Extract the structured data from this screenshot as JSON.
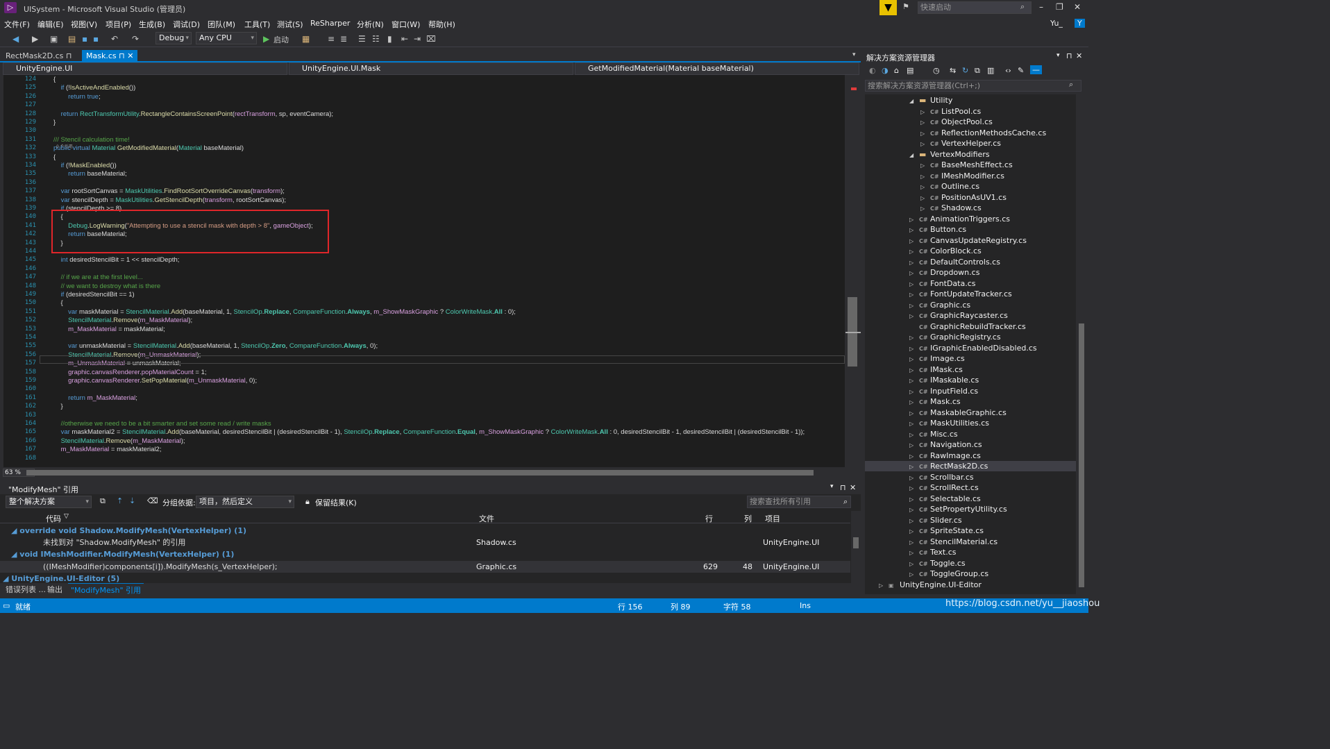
{
  "window": {
    "title": "UISystem - Microsoft Visual Studio (管理员)",
    "quick_launch": "快速启动",
    "user": "Yu_",
    "user_icon": "Y"
  },
  "menu": [
    "文件(F)",
    "编辑(E)",
    "视图(V)",
    "项目(P)",
    "生成(B)",
    "调试(D)",
    "团队(M)",
    "工具(T)",
    "测试(S)",
    "ReSharper",
    "分析(N)",
    "窗口(W)",
    "帮助(H)"
  ],
  "toolbar": {
    "config": "Debug",
    "platform": "Any CPU",
    "start": "启动"
  },
  "tabs": [
    {
      "label": "RectMask2D.cs",
      "pin": "⊓"
    },
    {
      "label": "Mask.cs",
      "pin": "⊓",
      "close": "✕"
    }
  ],
  "navbar": {
    "project": "UnityEngine.UI",
    "class": "UnityEngine.UI.Mask",
    "member": "GetModifiedMaterial(Material baseMaterial)"
  },
  "zoom": "63 %",
  "code_lines": [
    {
      "n": "124",
      "html": "{"
    },
    {
      "n": "125",
      "html": "    <span class='kw'>if</span> (!<span class='fn'>IsActiveAndEnabled</span>())"
    },
    {
      "n": "126",
      "html": "        <span class='kw'>return</span> <span class='kw'>true</span>;"
    },
    {
      "n": "127",
      "html": ""
    },
    {
      "n": "128",
      "html": "    <span class='kw'>return</span> <span class='ty'>RectTransformUtility</span>.<span class='fn'>RectangleContainsScreenPoint</span>(<span class='pr'>rectTransform</span>, sp, eventCamera);"
    },
    {
      "n": "129",
      "html": "}"
    },
    {
      "n": "130",
      "html": ""
    },
    {
      "n": "131",
      "html": "<span class='cm'>/// Stencil calculation time!</span>"
    },
    {
      "n": "132",
      "html": "<span class='kw'>public virtual</span> <span class='ty'>Material</span> <span class='fn'>GetModifiedMaterial</span>(<span class='ty'>Material</span> baseMaterial)"
    },
    {
      "n": "133",
      "html": "{"
    },
    {
      "n": "134",
      "html": "    <span class='kw'>if</span> (!<span class='fn'>MaskEnabled</span>())"
    },
    {
      "n": "135",
      "html": "        <span class='kw'>return</span> baseMaterial;"
    },
    {
      "n": "136",
      "html": ""
    },
    {
      "n": "137",
      "html": "    <span class='kw'>var</span> rootSortCanvas = <span class='ty'>MaskUtilities</span>.<span class='fn'>FindRootSortOverrideCanvas</span>(<span class='pr'>transform</span>);"
    },
    {
      "n": "138",
      "html": "    <span class='kw'>var</span> stencilDepth = <span class='ty'>MaskUtilities</span>.<span class='fn'>GetStencilDepth</span>(<span class='pr'>transform</span>, rootSortCanvas);"
    },
    {
      "n": "139",
      "html": "    <span class='kw'>if</span> (stencilDepth >= 8)"
    },
    {
      "n": "140",
      "html": "    {"
    },
    {
      "n": "141",
      "html": "        <span class='ty'>Debug</span>.<span class='fn'>LogWarning</span>(<span class='st'>\"Attempting to use a stencil mask with depth > 8\"</span>, <span class='pr'>gameObject</span>);"
    },
    {
      "n": "142",
      "html": "        <span class='kw'>return</span> baseMaterial;"
    },
    {
      "n": "143",
      "html": "    }"
    },
    {
      "n": "144",
      "html": ""
    },
    {
      "n": "145",
      "html": "    <span class='kw'>int</span> desiredStencilBit = 1 << stencilDepth;"
    },
    {
      "n": "146",
      "html": ""
    },
    {
      "n": "147",
      "html": "    <span class='cm'>// if we are at the first level...</span>"
    },
    {
      "n": "148",
      "html": "    <span class='cm'>// we want to destroy what is there</span>"
    },
    {
      "n": "149",
      "html": "    <span class='kw'>if</span> (desiredStencilBit == 1)"
    },
    {
      "n": "150",
      "html": "    {"
    },
    {
      "n": "151",
      "html": "        <span class='kw'>var</span> maskMaterial = <span class='ty'>StencilMaterial</span>.<span class='fn'>Add</span>(baseMaterial, 1, <span class='ty'>StencilOp</span>.<b class='ty'>Replace</b>, <span class='ty'>CompareFunction</span>.<b class='ty'>Always</b>, <span class='pr'>m_ShowMaskGraphic</span> ? <span class='ty'>ColorWriteMask</span>.<b class='ty'>All</b> : 0);"
    },
    {
      "n": "152",
      "html": "        <span class='ty'>StencilMaterial</span>.<span class='fn'>Remove</span>(<span class='pr'>m_MaskMaterial</span>);"
    },
    {
      "n": "153",
      "html": "        <span class='pr'>m_MaskMaterial</span> = maskMaterial;"
    },
    {
      "n": "154",
      "html": ""
    },
    {
      "n": "155",
      "html": "        <span class='kw'>var</span> unmaskMaterial = <span class='ty'>StencilMaterial</span>.<span class='fn'>Add</span>(baseMaterial, 1, <span class='ty'>StencilOp</span>.<b class='ty'>Zero</b>, <span class='ty'>CompareFunction</span>.<b class='ty'>Always</b>, 0);"
    },
    {
      "n": "156",
      "html": "        <span class='ty'>StencilMaterial</span>.<span class='fn'>Remove</span>(<span class='pr'>m_UnmaskMaterial</span>);"
    },
    {
      "n": "157",
      "html": "        <span class='pr'>m_UnmaskMaterial</span> = unmaskMaterial;"
    },
    {
      "n": "158",
      "html": "        <span class='pr'>graphic</span>.<span class='pr'>canvasRenderer</span>.<span class='pr'>popMaterialCount</span> = 1;"
    },
    {
      "n": "159",
      "html": "        <span class='pr'>graphic</span>.<span class='pr'>canvasRenderer</span>.<span class='fn'>SetPopMaterial</span>(<span class='pr'>m_UnmaskMaterial</span>, 0);"
    },
    {
      "n": "160",
      "html": ""
    },
    {
      "n": "161",
      "html": "        <span class='kw'>return</span> <span class='pr'>m_MaskMaterial</span>;"
    },
    {
      "n": "162",
      "html": "    }"
    },
    {
      "n": "163",
      "html": ""
    },
    {
      "n": "164",
      "html": "    <span class='cm'>//otherwise we need to be a bit smarter and set some read / write masks</span>"
    },
    {
      "n": "165",
      "html": "    <span class='kw'>var</span> maskMaterial2 = <span class='ty'>StencilMaterial</span>.<span class='fn'>Add</span>(baseMaterial, desiredStencilBit | (desiredStencilBit - 1), <span class='ty'>StencilOp</span>.<b class='ty'>Replace</b>, <span class='ty'>CompareFunction</span>.<b class='ty'>Equal</b>, <span class='pr'>m_ShowMaskGraphic</span> ? <span class='ty'>ColorWriteMask</span>.<b class='ty'>All</b> : 0, desiredStencilBit - 1, desiredStencilBit | (desiredStencilBit - 1));"
    },
    {
      "n": "166",
      "html": "    <span class='ty'>StencilMaterial</span>.<span class='fn'>Remove</span>(<span class='pr'>m_MaskMaterial</span>);"
    },
    {
      "n": "167",
      "html": "    <span class='pr'>m_MaskMaterial</span> = maskMaterial2;"
    },
    {
      "n": "168",
      "html": ""
    }
  ],
  "codelens": "0 个引用",
  "solution": {
    "title": "解决方案资源管理器",
    "search": "搜索解决方案资源管理器(Ctrl+;)",
    "items": [
      {
        "label": "Utility",
        "type": "folder",
        "lvl": 1,
        "open": true
      },
      {
        "label": "ListPool.cs",
        "lvl": 2
      },
      {
        "label": "ObjectPool.cs",
        "lvl": 2
      },
      {
        "label": "ReflectionMethodsCache.cs",
        "lvl": 2
      },
      {
        "label": "VertexHelper.cs",
        "lvl": 2
      },
      {
        "label": "VertexModifiers",
        "type": "folder",
        "lvl": 1,
        "open": true
      },
      {
        "label": "BaseMeshEffect.cs",
        "lvl": 2
      },
      {
        "label": "IMeshModifier.cs",
        "lvl": 2
      },
      {
        "label": "Outline.cs",
        "lvl": 2
      },
      {
        "label": "PositionAsUV1.cs",
        "lvl": 2
      },
      {
        "label": "Shadow.cs",
        "lvl": 2
      },
      {
        "label": "AnimationTriggers.cs",
        "lvl": 1
      },
      {
        "label": "Button.cs",
        "lvl": 1
      },
      {
        "label": "CanvasUpdateRegistry.cs",
        "lvl": 1
      },
      {
        "label": "ColorBlock.cs",
        "lvl": 1
      },
      {
        "label": "DefaultControls.cs",
        "lvl": 1
      },
      {
        "label": "Dropdown.cs",
        "lvl": 1
      },
      {
        "label": "FontData.cs",
        "lvl": 1
      },
      {
        "label": "FontUpdateTracker.cs",
        "lvl": 1
      },
      {
        "label": "Graphic.cs",
        "lvl": 1
      },
      {
        "label": "GraphicRaycaster.cs",
        "lvl": 1
      },
      {
        "label": "GraphicRebuildTracker.cs",
        "lvl": 1,
        "noarrow": true
      },
      {
        "label": "GraphicRegistry.cs",
        "lvl": 1
      },
      {
        "label": "IGraphicEnabledDisabled.cs",
        "lvl": 1
      },
      {
        "label": "Image.cs",
        "lvl": 1
      },
      {
        "label": "IMask.cs",
        "lvl": 1
      },
      {
        "label": "IMaskable.cs",
        "lvl": 1
      },
      {
        "label": "InputField.cs",
        "lvl": 1
      },
      {
        "label": "Mask.cs",
        "lvl": 1
      },
      {
        "label": "MaskableGraphic.cs",
        "lvl": 1
      },
      {
        "label": "MaskUtilities.cs",
        "lvl": 1
      },
      {
        "label": "Misc.cs",
        "lvl": 1
      },
      {
        "label": "Navigation.cs",
        "lvl": 1
      },
      {
        "label": "RawImage.cs",
        "lvl": 1
      },
      {
        "label": "RectMask2D.cs",
        "lvl": 1,
        "selected": true
      },
      {
        "label": "Scrollbar.cs",
        "lvl": 1
      },
      {
        "label": "ScrollRect.cs",
        "lvl": 1
      },
      {
        "label": "Selectable.cs",
        "lvl": 1
      },
      {
        "label": "SetPropertyUtility.cs",
        "lvl": 1
      },
      {
        "label": "Slider.cs",
        "lvl": 1
      },
      {
        "label": "SpriteState.cs",
        "lvl": 1
      },
      {
        "label": "StencilMaterial.cs",
        "lvl": 1
      },
      {
        "label": "Text.cs",
        "lvl": 1
      },
      {
        "label": "Toggle.cs",
        "lvl": 1
      },
      {
        "label": "ToggleGroup.cs",
        "lvl": 1
      },
      {
        "label": "UnityEngine.UI-Editor",
        "type": "project",
        "lvl": 0
      }
    ]
  },
  "refs": {
    "title": "\"ModifyMesh\" 引用",
    "scope": "整个解决方案",
    "group_label": "分组依据:",
    "group": "项目，然后定义",
    "keep": "保留结果(K)",
    "search": "搜索查找所有引用",
    "cols": {
      "code": "代码",
      "file": "文件",
      "line": "行",
      "col": "列",
      "project": "项目"
    },
    "rows": [
      {
        "kind": "group",
        "text": "override void Shadow.ModifyMesh(VertexHelper) (1)",
        "indent": 16
      },
      {
        "kind": "item",
        "text": "未找到对 \"Shadow.ModifyMesh\" 的引用",
        "file": "Shadow.cs",
        "line": "",
        "col": "",
        "project": "UnityEngine.UI",
        "indent": 62
      },
      {
        "kind": "group",
        "text": "void IMeshModifier.ModifyMesh(VertexHelper) (1)",
        "indent": 16
      },
      {
        "kind": "item",
        "text": "((IMeshModifier)components[i]).ModifyMesh(s_VertexHelper);",
        "file": "Graphic.cs",
        "line": "629",
        "col": "48",
        "project": "UnityEngine.UI",
        "indent": 62,
        "sel": true
      },
      {
        "kind": "group",
        "text": "UnityEngine.UI-Editor (5)",
        "indent": 4
      }
    ]
  },
  "bottom_tabs": [
    "错误列表 ...",
    "输出",
    "\"ModifyMesh\" 引用"
  ],
  "status": {
    "ready": "就绪",
    "line": "行 156",
    "col": "列 89",
    "char": "字符 58",
    "ins": "Ins",
    "watermark": "https://blog.csdn.net/yu__jiaoshou"
  }
}
